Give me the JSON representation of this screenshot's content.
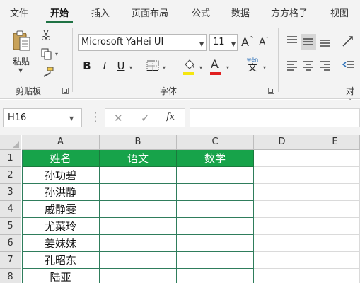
{
  "menu": {
    "tabs": [
      "文件",
      "开始",
      "插入",
      "页面布局",
      "公式",
      "数据",
      "方方格子",
      "视图"
    ],
    "active_tab": "开始"
  },
  "ribbon": {
    "clipboard": {
      "paste_label": "粘贴",
      "group_label": "剪贴板"
    },
    "font": {
      "font_name": "Microsoft YaHei UI",
      "font_size": "11",
      "bold": "B",
      "italic": "I",
      "underline": "U",
      "grow": "A",
      "shrink": "A",
      "wen": "wén",
      "wen_char": "文",
      "group_label": "字体",
      "fill_color": "#f5e60f",
      "font_color": "#e02020"
    },
    "alignment": {
      "group_label": "对齐"
    }
  },
  "formula_bar": {
    "name_box": "H16",
    "fx": "fx",
    "cancel_icon": "close-icon",
    "enter_icon": "check-icon"
  },
  "sheet": {
    "columns": [
      "A",
      "B",
      "C",
      "D",
      "E"
    ],
    "rows": [
      "1",
      "2",
      "3",
      "4",
      "5",
      "6",
      "7",
      "8"
    ],
    "header": [
      "姓名",
      "语文",
      "数学"
    ],
    "names": [
      "孙功碧",
      "孙洪静",
      "戚静雯",
      "尤菜玲",
      "姜妹妹",
      "孔昭东",
      "陆亚"
    ],
    "header_color": "#17a34a"
  }
}
